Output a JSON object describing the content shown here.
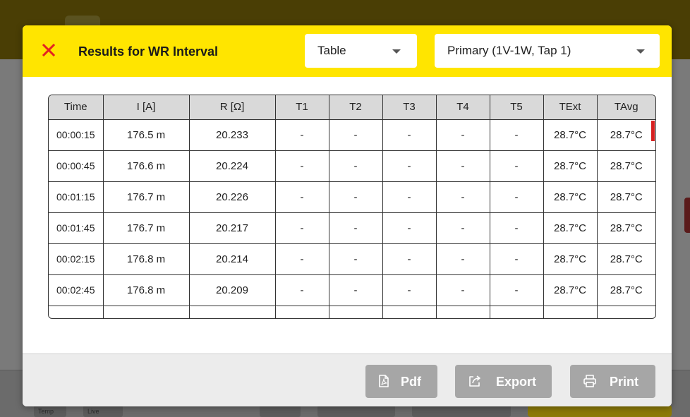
{
  "dialog": {
    "title": "Results for WR Interval",
    "view_select": "Table",
    "winding_select": "Primary (1V-1W, Tap 1)"
  },
  "table": {
    "headers": [
      "Time",
      "I [A]",
      "R [Ω]",
      "T1",
      "T2",
      "T3",
      "T4",
      "T5",
      "TExt",
      "TAvg"
    ],
    "rows": [
      [
        "00:00:15",
        "176.5 m",
        "20.233",
        "-",
        "-",
        "-",
        "-",
        "-",
        "28.7°C",
        "28.7°C"
      ],
      [
        "00:00:45",
        "176.6 m",
        "20.224",
        "-",
        "-",
        "-",
        "-",
        "-",
        "28.7°C",
        "28.7°C"
      ],
      [
        "00:01:15",
        "176.7 m",
        "20.226",
        "-",
        "-",
        "-",
        "-",
        "-",
        "28.7°C",
        "28.7°C"
      ],
      [
        "00:01:45",
        "176.7 m",
        "20.217",
        "-",
        "-",
        "-",
        "-",
        "-",
        "28.7°C",
        "28.7°C"
      ],
      [
        "00:02:15",
        "176.8 m",
        "20.214",
        "-",
        "-",
        "-",
        "-",
        "-",
        "28.7°C",
        "28.7°C"
      ],
      [
        "00:02:45",
        "176.8 m",
        "20.209",
        "-",
        "-",
        "-",
        "-",
        "-",
        "28.7°C",
        "28.7°C"
      ]
    ]
  },
  "footer": {
    "pdf_label": "Pdf",
    "export_label": "Export",
    "print_label": "Print"
  },
  "background": {
    "chip_temp": "Temp",
    "chip_live": "Live"
  },
  "icons": {
    "close": "close-icon",
    "pdf": "pdf-file-icon",
    "export": "export-icon",
    "print": "printer-icon"
  },
  "colors": {
    "header_yellow": "#ffe500",
    "close_red": "#e32222",
    "button_gray": "#a6a6a6",
    "scroll_indicator": "#d62020"
  }
}
